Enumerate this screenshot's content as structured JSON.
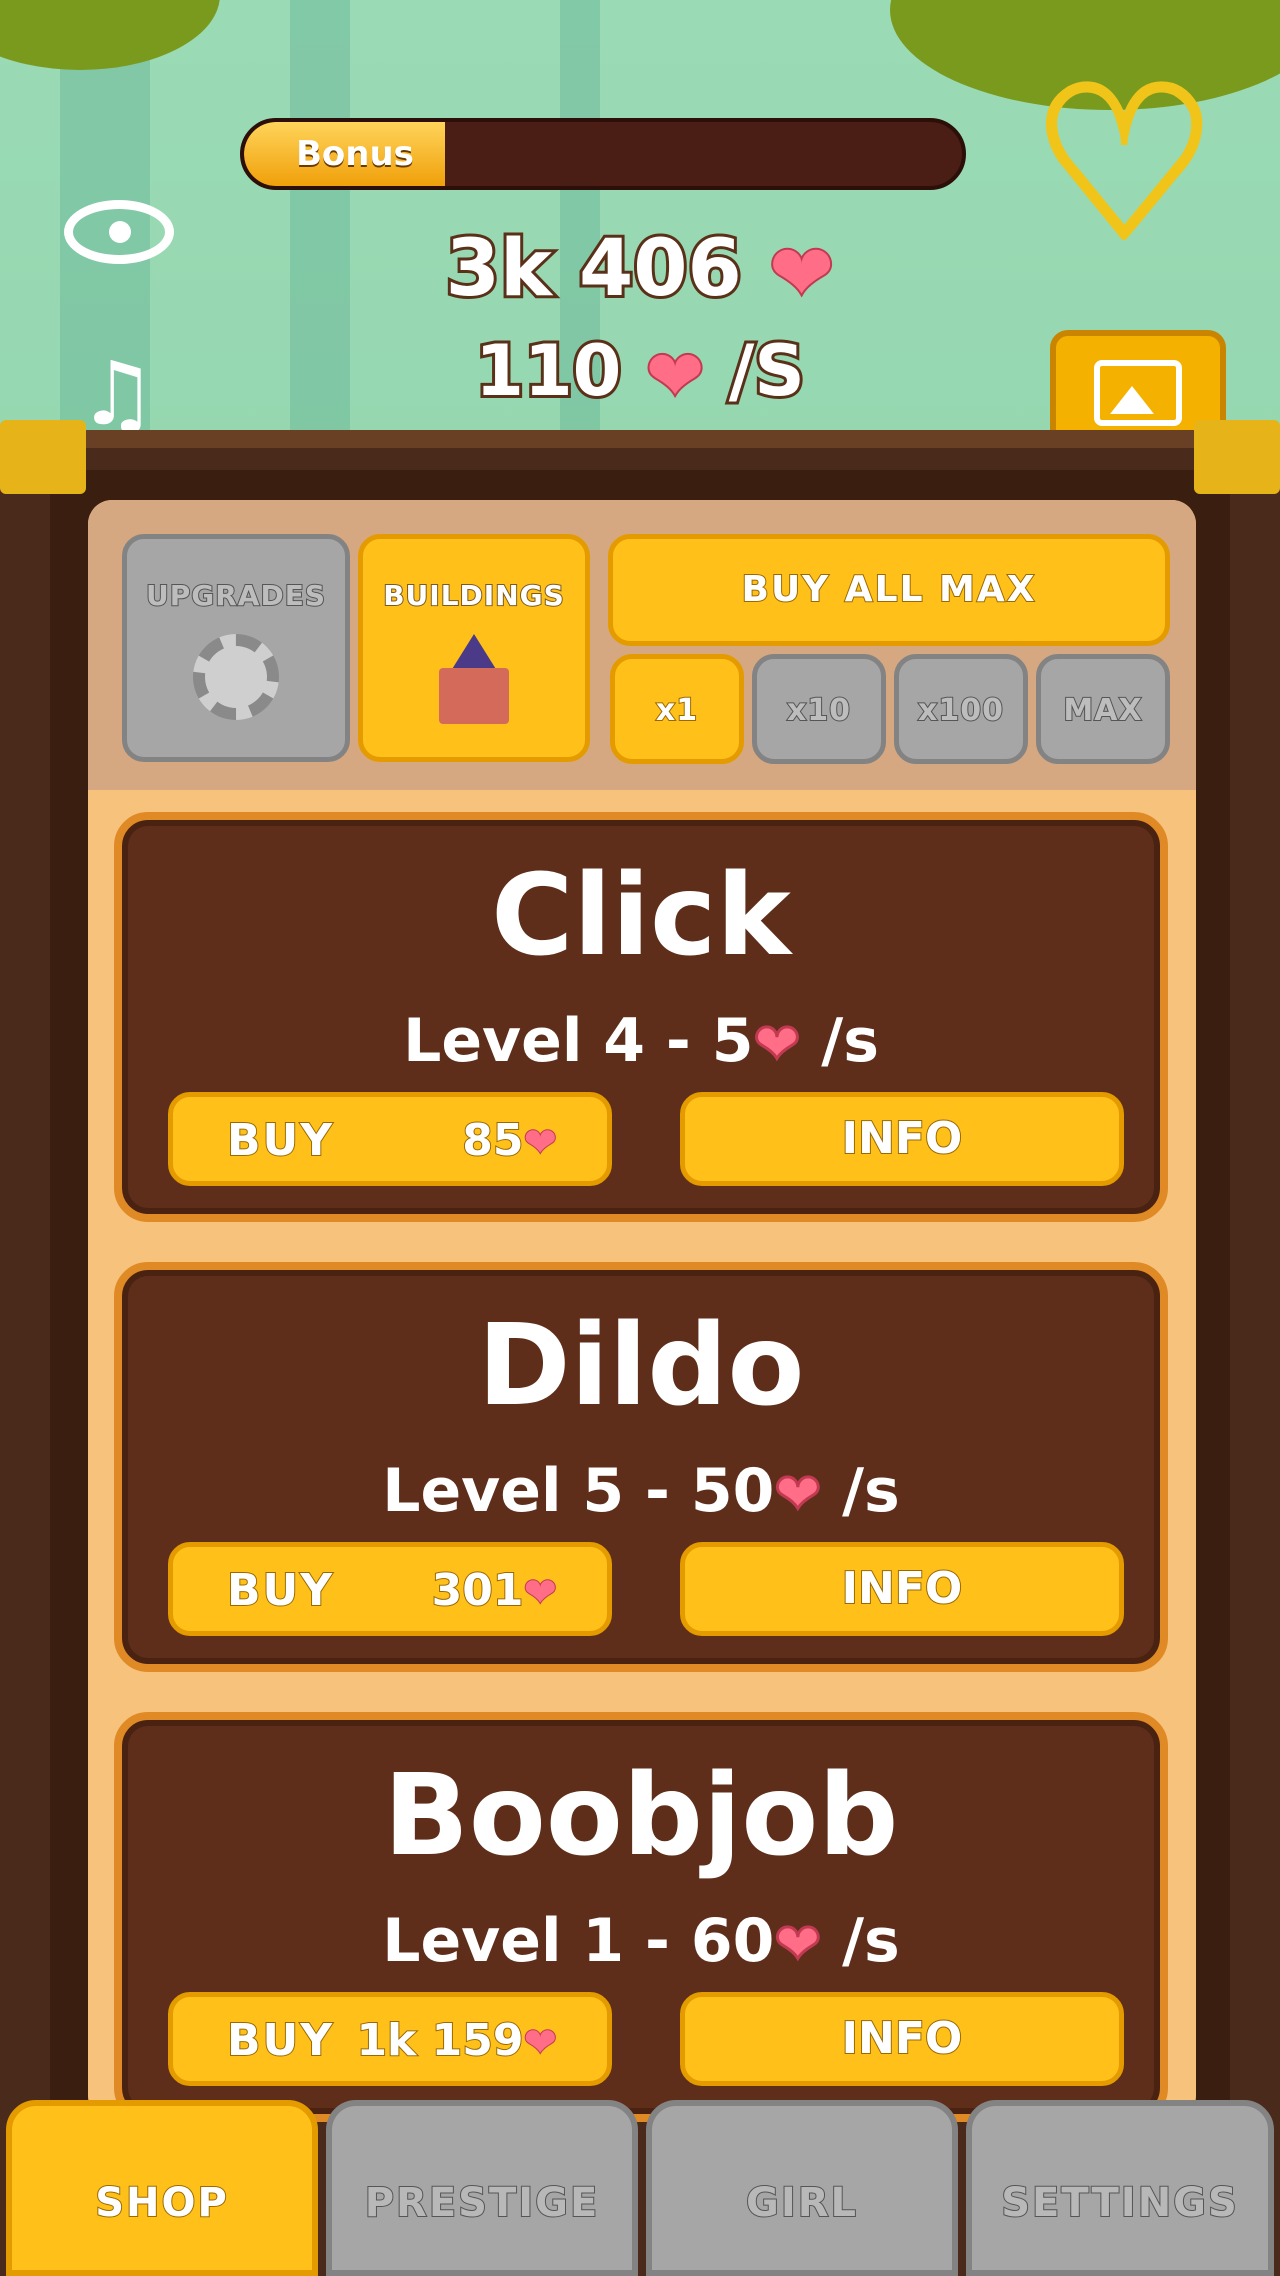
{
  "hud": {
    "bonus_label": "Bonus",
    "bonus_progress": 0.28,
    "hearts_total": "3k 406",
    "hearts_rate": "110",
    "rate_unit": "/S",
    "heart_glyph": "❤"
  },
  "tabs": {
    "upgrades": "UPGRADES",
    "buildings": "BUILDINGS",
    "buy_all_max": "BUY ALL MAX",
    "multipliers": [
      "x1",
      "x10",
      "x100",
      "MAX"
    ],
    "selected_multiplier": "x1"
  },
  "buildings": [
    {
      "name": "Click",
      "level_text": "Level 4 - 5",
      "unit": " /s",
      "buy_label": "BUY",
      "price": "85",
      "info_label": "INFO"
    },
    {
      "name": "Dildo",
      "level_text": "Level 5 - 50",
      "unit": " /s",
      "buy_label": "BUY",
      "price": "301",
      "info_label": "INFO"
    },
    {
      "name": "Boobjob",
      "level_text": "Level 1 - 60",
      "unit": " /s",
      "buy_label": "BUY",
      "price": "1k 159",
      "info_label": "INFO"
    }
  ],
  "nav": {
    "shop": "SHOP",
    "prestige": "PRESTIGE",
    "girl": "GIRL",
    "settings": "SETTINGS",
    "active": "SHOP"
  },
  "colors": {
    "accent_gold": "#ffc01a",
    "inactive_grey": "#a6a6a6",
    "card_brown": "#5e2e1a",
    "heart_pink": "#ff6d86"
  }
}
